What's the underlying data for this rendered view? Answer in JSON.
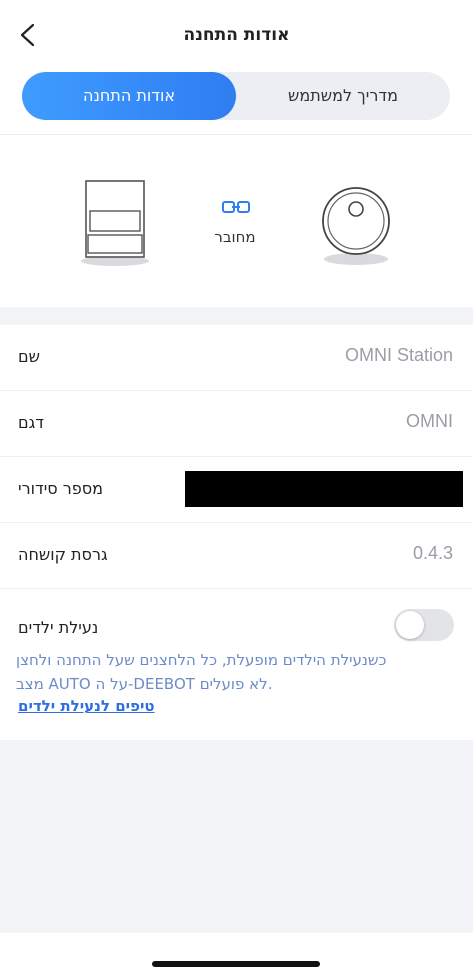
{
  "header": {
    "title": "אודות התחנה"
  },
  "tabs": {
    "active_label": "אודות התחנה",
    "inactive_label": "מדריך למשתמש"
  },
  "device": {
    "connection_label": "מחובר",
    "accent_color": "#2f7df2"
  },
  "info": {
    "name_label": "שם",
    "name_value": "OMNI Station",
    "model_label": "דגם",
    "model_value": "OMNI",
    "serial_label": "מספר סידורי",
    "firmware_label": "גרסת קושחה",
    "firmware_value": "0.4.3"
  },
  "child_lock": {
    "label": "נעילת ילדים",
    "enabled": false,
    "description_line1": "כשנעילת הילדים מופעלת, כל הלחצנים שעל התחנה ולחצן",
    "description_line2": ".לא פועלים DEEBOT-על ה AUTO מצב",
    "tips_link": "טיפים לנעילת ילדים"
  },
  "icons": {
    "back": "chevron-left-icon",
    "link": "link-icon",
    "station": "station-icon",
    "robot": "robot-vacuum-icon"
  }
}
